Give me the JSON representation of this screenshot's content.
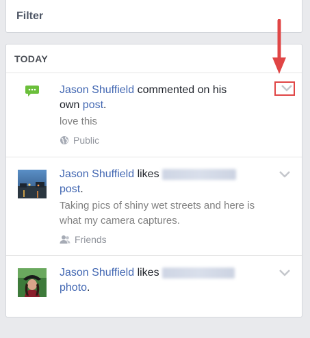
{
  "filter": {
    "label": "Filter"
  },
  "section": {
    "title": "TODAY"
  },
  "items": [
    {
      "actor": "Jason Shuffield",
      "verb": " commented on his",
      "line2_prefix": "own ",
      "object": "post",
      "line2_suffix": ".",
      "body": "love this",
      "audience": "Public",
      "audience_icon": "globe-icon",
      "icon": "comment-icon"
    },
    {
      "actor": "Jason Shuffield",
      "verb": " likes ",
      "object": "post",
      "object_suffix": ".",
      "body": "Taking pics of shiny wet streets and here is what my camera captures.",
      "audience": "Friends",
      "audience_icon": "friends-icon",
      "icon": "street-photo-thumbnail"
    },
    {
      "actor": "Jason Shuffield",
      "verb": " likes ",
      "object": "photo",
      "object_suffix": ".",
      "icon": "pirate-photo-thumbnail"
    }
  ],
  "colors": {
    "link": "#4267b2",
    "annotation": "#e04545",
    "background": "#e9eaed"
  }
}
